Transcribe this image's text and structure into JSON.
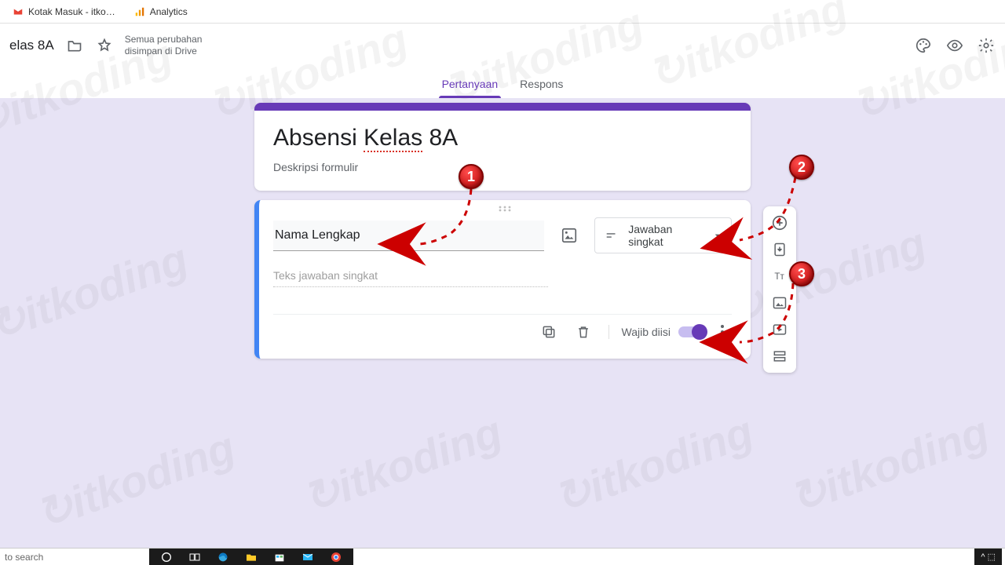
{
  "browser_tabs": [
    {
      "label": "Kotak Masuk - itko…",
      "icon": "gmail"
    },
    {
      "label": "Analytics",
      "icon": "ga"
    }
  ],
  "header": {
    "doc_title": "elas 8A",
    "save_status_line1": "Semua perubahan",
    "save_status_line2": "disimpan di Drive"
  },
  "tabs": {
    "questions": "Pertanyaan",
    "responses": "Respons",
    "active": "questions"
  },
  "form": {
    "title_plain_prefix": "Absensi ",
    "title_underlined": "Kelas",
    "title_plain_suffix": " 8A",
    "description_placeholder": "Deskripsi formulir"
  },
  "question": {
    "title": "Nama Lengkap",
    "type_label": "Jawaban singkat",
    "answer_placeholder": "Teks jawaban singkat",
    "required_label": "Wajib diisi",
    "required_on": true
  },
  "side_toolbar": {
    "items": [
      {
        "name": "add-question",
        "icon": "plus-circle"
      },
      {
        "name": "import-questions",
        "icon": "import-doc"
      },
      {
        "name": "add-title",
        "icon": "text-tt"
      },
      {
        "name": "add-image",
        "icon": "image"
      },
      {
        "name": "add-video",
        "icon": "video"
      },
      {
        "name": "add-section",
        "icon": "section"
      }
    ]
  },
  "annotations": {
    "b1": "1",
    "b2": "2",
    "b3": "3"
  },
  "taskbar": {
    "search_placeholder": "to search",
    "tray": "^  ⬚"
  },
  "watermark_text": "↻itkoding"
}
